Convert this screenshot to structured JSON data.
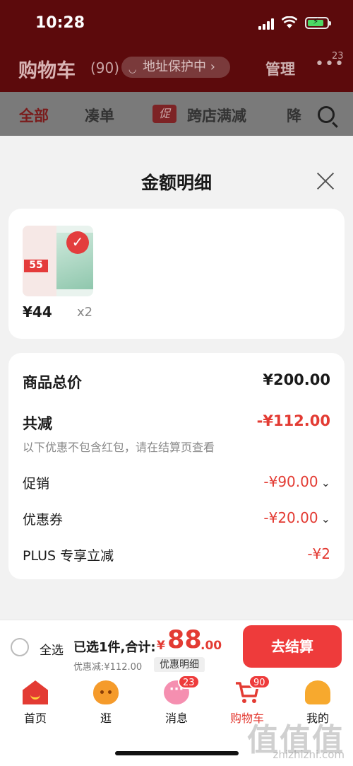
{
  "status": {
    "time": "10:28"
  },
  "header": {
    "title": "购物车",
    "count": "(90)",
    "address_pill": "地址保护中 ›",
    "manage": "管理",
    "more": "•••",
    "more_badge": "23"
  },
  "tabs": {
    "all": "全部",
    "combine": "凑单",
    "promo_icon": "促",
    "cross_store": "跨店满减",
    "price_drop": "降"
  },
  "sheet": {
    "title": "金额明细",
    "item": {
      "price": "¥44",
      "qty": "x2",
      "thumb_tag": "55"
    },
    "rows": {
      "goods_total_label": "商品总价",
      "goods_total_value": "¥200.00",
      "reduce_label": "共减",
      "reduce_value": "-¥112.00",
      "note": "以下优惠不包含红包，请在结算页查看",
      "promo_label": "促销",
      "promo_value": "-¥90.00",
      "coupon_label": "优惠券",
      "coupon_value": "-¥20.00",
      "plus_label": "PLUS 专享立减",
      "plus_value": "-¥2",
      "chevron": "⌄"
    }
  },
  "settle": {
    "select_all": "全选",
    "chosen": "已选1件,合计:",
    "currency": "¥",
    "total_int": "88",
    "total_dec": ".00",
    "discount": "优惠减:¥112.00",
    "detail": "优惠明细",
    "checkout": "去结算"
  },
  "tabbar": {
    "home": "首页",
    "guang": "逛",
    "messages": "消息",
    "messages_badge": "23",
    "cart": "购物车",
    "cart_badge": "90",
    "me": "我的"
  },
  "watermark": {
    "text": "值值值",
    "url": "zhizhizhi.com"
  },
  "colors": {
    "accent": "#e33b33",
    "header_bg": "#5c0a0c"
  }
}
